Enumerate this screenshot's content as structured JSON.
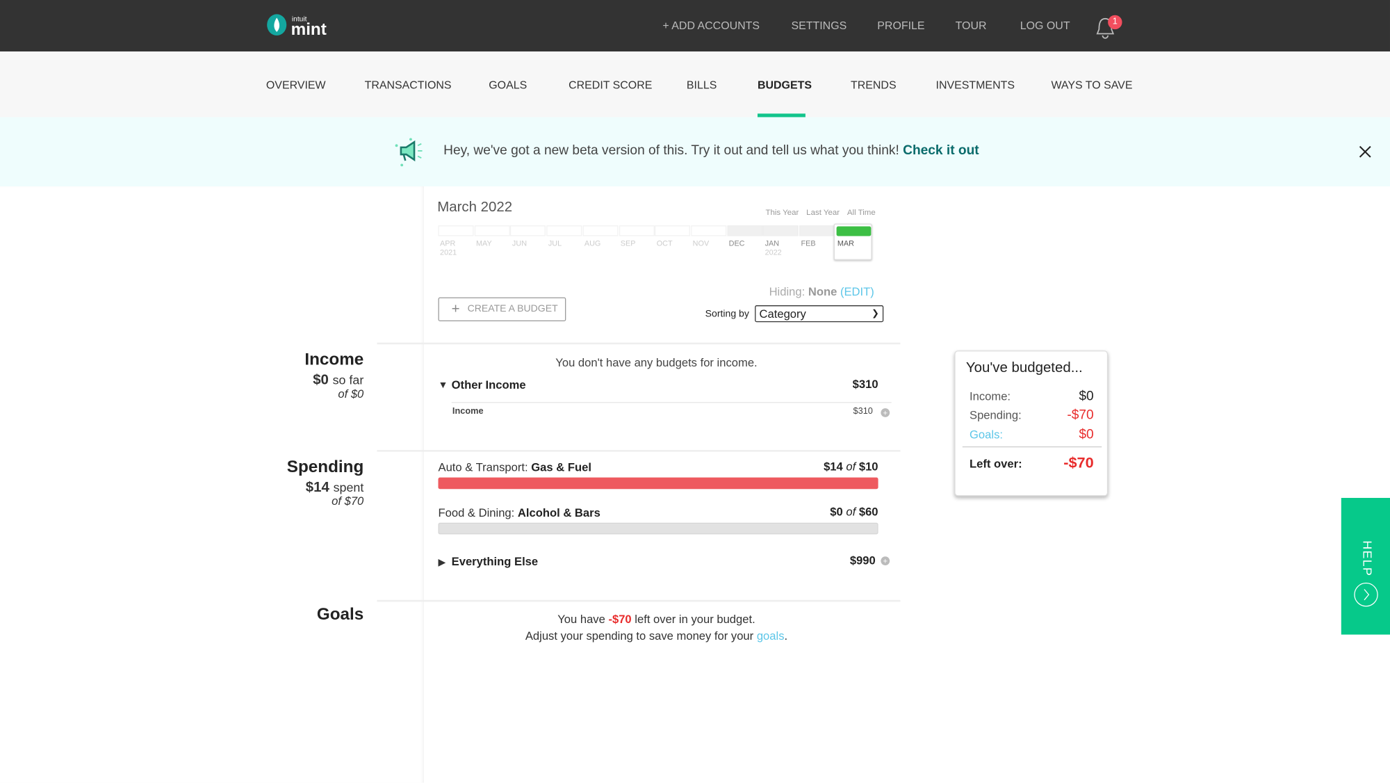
{
  "brand": {
    "logo_text": "mint",
    "logo_sub": "intuit"
  },
  "topbar": {
    "links": [
      "+ ADD ACCOUNTS",
      "SETTINGS",
      "PROFILE",
      "TOUR",
      "LOG OUT"
    ],
    "notification_count": "1"
  },
  "nav": {
    "items": [
      "OVERVIEW",
      "TRANSACTIONS",
      "GOALS",
      "CREDIT SCORE",
      "BILLS",
      "BUDGETS",
      "TRENDS",
      "INVESTMENTS",
      "WAYS TO SAVE"
    ],
    "active": "BUDGETS"
  },
  "banner": {
    "text": "Hey, we've got a new beta version of this. Try it out and tell us what you think!",
    "link": "Check it out"
  },
  "period": {
    "title": "March 2022",
    "ranges": [
      "This Year",
      "Last Year",
      "All Time"
    ],
    "months": [
      {
        "m": "APR",
        "y": "2021"
      },
      {
        "m": "MAY"
      },
      {
        "m": "JUN"
      },
      {
        "m": "JUL"
      },
      {
        "m": "AUG"
      },
      {
        "m": "SEP"
      },
      {
        "m": "OCT"
      },
      {
        "m": "NOV"
      },
      {
        "m": "DEC"
      },
      {
        "m": "JAN",
        "y": "2022"
      },
      {
        "m": "FEB"
      },
      {
        "m": "MAR"
      }
    ],
    "selected": "MAR"
  },
  "controls": {
    "create_label": "CREATE A BUDGET",
    "hiding_label": "Hiding:",
    "hiding_value": "None",
    "edit_label": "(EDIT)",
    "sort_label": "Sorting by",
    "sort_value": "Category"
  },
  "income": {
    "title": "Income",
    "amount": "$0",
    "suffix": "so far",
    "of": "of $0",
    "empty_msg": "You don't have any budgets for income.",
    "group": {
      "name": "Other Income",
      "amount": "$310"
    },
    "item": {
      "name": "Income",
      "amount": "$310"
    }
  },
  "spending": {
    "title": "Spending",
    "amount": "$14",
    "suffix": "spent",
    "of": "of $70",
    "budgets": [
      {
        "category": "Auto & Transport:",
        "sub": "Gas & Fuel",
        "spent": "$14",
        "of": "of",
        "budget": "$10",
        "progress": 1.0,
        "color": "#ee5a5f"
      },
      {
        "category": "Food & Dining:",
        "sub": "Alcohol & Bars",
        "spent": "$0",
        "of": "of",
        "budget": "$60",
        "progress": 0,
        "color": "#e2e2e2"
      }
    ],
    "everything_else": {
      "name": "Everything Else",
      "amount": "$990"
    }
  },
  "goals": {
    "title": "Goals",
    "msg_pre": "You have",
    "msg_amount": "-$70",
    "msg_post": "left over in your budget.",
    "msg2_pre": "Adjust your spending to save money for your",
    "msg2_link": "goals",
    "msg2_post": "."
  },
  "summary": {
    "title": "You've budgeted...",
    "income_label": "Income:",
    "income": "$0",
    "spending_label": "Spending:",
    "spending": "-$70",
    "goals_label": "Goals:",
    "goals": "$0",
    "left_label": "Left over:",
    "left": "-$70"
  },
  "help": {
    "label": "HELP"
  },
  "colors": {
    "accent": "#12c48b",
    "negative": "#e82c2c",
    "link": "#5cc6e8",
    "topbar": "#333333",
    "banner": "#effdfd"
  }
}
